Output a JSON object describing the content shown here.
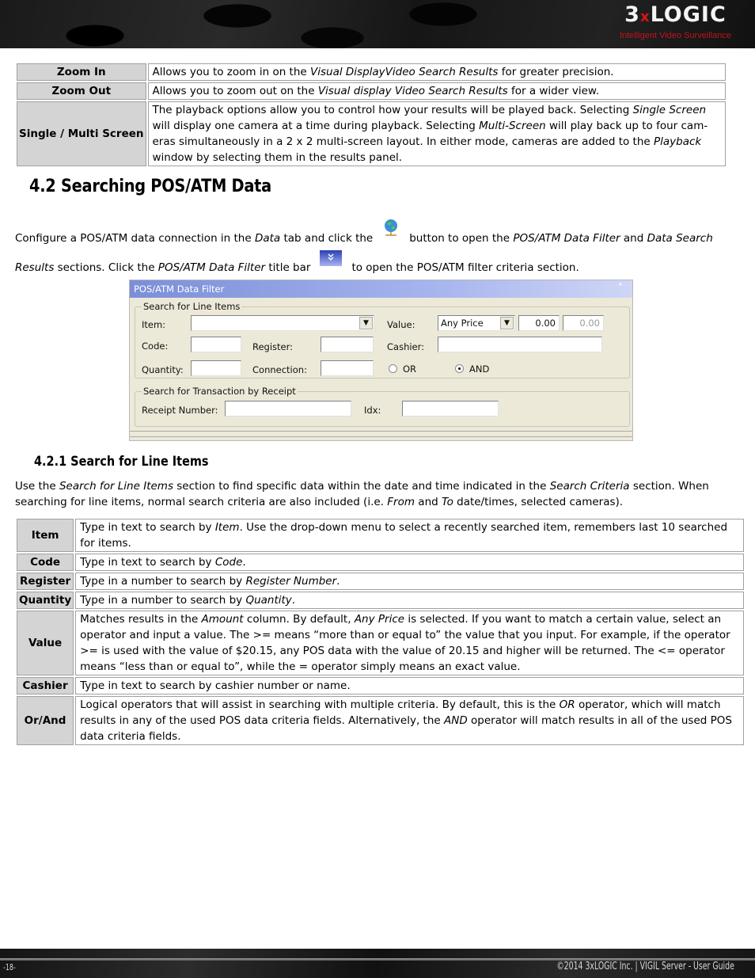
{
  "header": {
    "logo_main_a": "3",
    "logo_main_x": "x",
    "logo_main_b": "LOGIC",
    "logo_tagline": "Intelligent Video Surveillance"
  },
  "top_table": [
    {
      "key": "Zoom In",
      "parts": [
        {
          "t": "Allows you to zoom in on the "
        },
        {
          "t": "Visual DisplayVideo Search Results",
          "i": true
        },
        {
          "t": " for greater precision."
        }
      ]
    },
    {
      "key": "Zoom Out",
      "parts": [
        {
          "t": "Allows you to zoom out on the "
        },
        {
          "t": "Visual display Video Search Results",
          "i": true
        },
        {
          "t": " for a wider view."
        }
      ]
    },
    {
      "key": "Single / Multi Screen",
      "parts": [
        {
          "t": "The playback options allow you to control how your results will be played back. Selecting "
        },
        {
          "t": "Single Screen",
          "i": true
        },
        {
          "t": " will display one camera at a time during playback. Selecting "
        },
        {
          "t": "Multi-Screen",
          "i": true
        },
        {
          "t": " will play back up to four cam- eras simultaneously in a 2 x 2 multi-screen layout. In either mode, cameras are added to the "
        },
        {
          "t": "Playback",
          "i": true
        },
        {
          "t": " window by selecting them in the results panel."
        }
      ]
    }
  ],
  "section": {
    "title": "4.2 Searching POS/ATM Data",
    "para1": {
      "a": "Configure a POS/ATM data connection in the ",
      "b": "Data",
      "c": " tab and click the",
      "d": "button to open the ",
      "e": "POS/ATM Data Filter",
      "f": " and ",
      "g": "Data Search Results",
      "h": " sections. Click the ",
      "i": "POS/ATM Data Filter",
      "j": " title bar",
      "k": "to open the POS/ATM filter criteria section."
    },
    "icons": {
      "globe": "globe-network-icon",
      "expand": "double-chevron-down-icon"
    }
  },
  "filter_panel": {
    "title": "POS/ATM Data Filter",
    "collapse_glyph": "˄˄",
    "line_items_legend": "Search for Line Items",
    "labels": {
      "item": "Item:",
      "code": "Code:",
      "register": "Register:",
      "quantity": "Quantity:",
      "connection": "Connection:",
      "value": "Value:",
      "cashier": "Cashier:",
      "or": "OR",
      "and": "AND",
      "receipt_number": "Receipt Number:",
      "idx": "Idx:"
    },
    "values": {
      "item": "",
      "code": "",
      "register": "",
      "quantity": "",
      "connection": "",
      "value_operator": "Any Price",
      "value_from": "0.00",
      "value_to": "0.00",
      "cashier": "",
      "receipt_number": "",
      "idx": ""
    },
    "logic_selected": "AND",
    "receipt_legend": "Search for Transaction by Receipt"
  },
  "subsection": {
    "title": "4.2.1 Search for Line Items",
    "para": [
      {
        "t": "Use the "
      },
      {
        "t": "Search for Line Items",
        "i": true
      },
      {
        "t": " section to find specific data within the date and time indicated in the "
      },
      {
        "t": "Search Criteria",
        "i": true
      },
      {
        "t": " section. When searching for line items, normal search criteria are also included (i.e. "
      },
      {
        "t": "From",
        "i": true
      },
      {
        "t": " and "
      },
      {
        "t": "To",
        "i": true
      },
      {
        "t": " date/times, selected cameras)."
      }
    ]
  },
  "fields_table": [
    {
      "key": "Item",
      "parts": [
        {
          "t": "Type in text to search by "
        },
        {
          "t": "Item",
          "i": true
        },
        {
          "t": ". Use the drop-down menu to select a recently searched item, remembers last 10 searched for items."
        }
      ]
    },
    {
      "key": "Code",
      "parts": [
        {
          "t": "Type in text to search by "
        },
        {
          "t": "Code",
          "i": true
        },
        {
          "t": "."
        }
      ]
    },
    {
      "key": "Register",
      "parts": [
        {
          "t": "Type in a number to search by "
        },
        {
          "t": "Register Number",
          "i": true
        },
        {
          "t": "."
        }
      ]
    },
    {
      "key": "Quantity",
      "parts": [
        {
          "t": "Type in a number to search by "
        },
        {
          "t": "Quantity",
          "i": true
        },
        {
          "t": "."
        }
      ]
    },
    {
      "key": "Value",
      "parts": [
        {
          "t": "Matches results in the "
        },
        {
          "t": "Amount",
          "i": true
        },
        {
          "t": " column. By default, "
        },
        {
          "t": "Any Price",
          "i": true
        },
        {
          "t": " is selected. If you want to match a certain value, select an operator and input a value. The >= means “more than or equal to” the value that you input. For example, if the operator >= is used with the value of $20.15, any POS data with the value of 20.15 and higher will be returned. The <= operator means “less than or equal to”, while the = operator simply means an exact value."
        }
      ]
    },
    {
      "key": "Cashier",
      "parts": [
        {
          "t": "Type in text to search by cashier number or name."
        }
      ]
    },
    {
      "key": "Or/And",
      "parts": [
        {
          "t": "Logical operators that will assist in searching with multiple criteria. By default, this is the "
        },
        {
          "t": "OR",
          "i": true
        },
        {
          "t": " operator, which will match results in any of the used POS data criteria fields. Alternatively, the "
        },
        {
          "t": "AND",
          "i": true
        },
        {
          "t": " operator will match results in all of the used POS data criteria fields."
        }
      ]
    }
  ],
  "footer": {
    "page_number": "-18-",
    "copyright": "©2014 3xLOGIC Inc. | VIGIL Server - User Guide"
  }
}
